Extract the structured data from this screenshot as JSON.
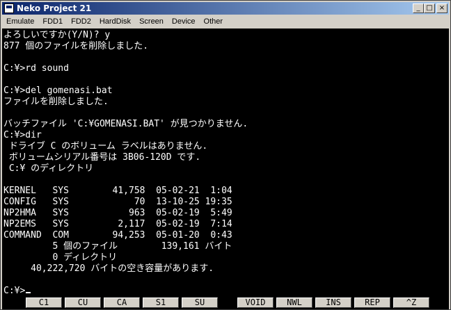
{
  "window": {
    "title": "Neko Project 21",
    "controls": {
      "minimize": "_",
      "maximize": "□",
      "close": "×"
    }
  },
  "menu": [
    "Emulate",
    "FDD1",
    "FDD2",
    "HardDisk",
    "Screen",
    "Device",
    "Other"
  ],
  "console": {
    "lines": [
      "よろしいですか(Y/N)? y",
      "877 個のファイルを削除しました.",
      "",
      "C:¥>rd sound",
      "",
      "C:¥>del gomenasi.bat",
      "ファイルを削除しました.",
      "",
      "バッチファイル 'C:¥GOMENASI.BAT' が見つかりません.",
      "C:¥>dir",
      " ドライブ C のボリューム ラベルはありません.",
      " ボリュームシリアル番号は 3B06-120D です.",
      " C:¥ のディレクトリ",
      "",
      "KERNEL   SYS        41,758  05-02-21  1:04",
      "CONFIG   SYS            70  13-10-25 19:35",
      "NP2HMA   SYS           963  05-02-19  5:49",
      "NP2EMS   SYS         2,117  05-02-19  7:14",
      "COMMAND  COM        94,253  05-01-20  0:43",
      "         5 個のファイル        139,161 バイト",
      "         0 ディレクトリ",
      "     40,222,720 バイトの空き容量があります.",
      "",
      "C:¥>"
    ]
  },
  "function_keys": [
    "C1",
    "CU",
    "CA",
    "S1",
    "SU",
    "VOID",
    "NWL",
    "INS",
    "REP",
    "^Z"
  ]
}
